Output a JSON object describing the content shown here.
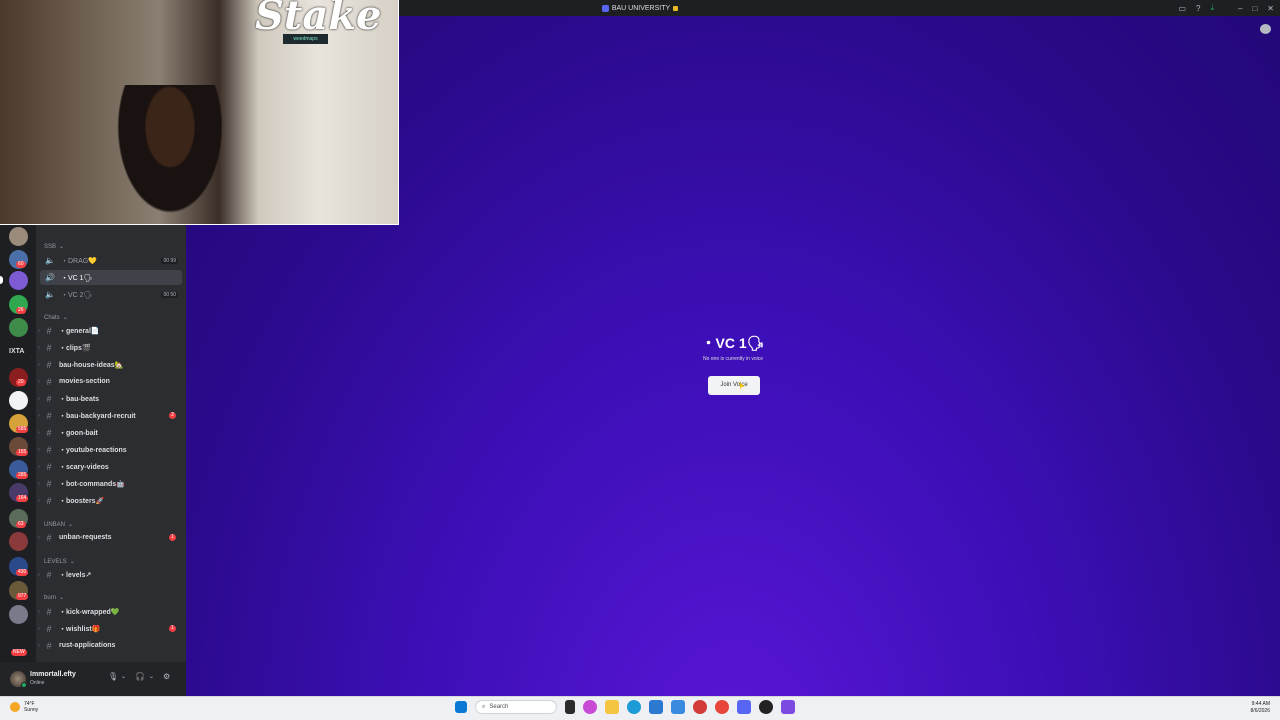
{
  "window": {
    "title": "BAU UNIVERSITY",
    "tools": [
      "inbox-icon",
      "help-icon",
      "download-icon"
    ],
    "controls": [
      "minimize",
      "maximize",
      "close"
    ]
  },
  "overlay": {
    "brand": "Stake",
    "sponsor": "weedmaps"
  },
  "rail": {
    "text_label": "IXTA",
    "badges": [
      "60",
      "26",
      "20",
      "585",
      "155",
      "285",
      "164",
      "63",
      "430",
      "977"
    ],
    "new_badge": "NEW"
  },
  "channels": {
    "categories": {
      "ssb": "SSB",
      "chats": "Chats",
      "unban": "UNBAN",
      "levels": "LEVELS",
      "burn": "burn"
    },
    "voice": [
      {
        "label": "・DRAG💛",
        "counter": "00 99"
      },
      {
        "label": "・VC 1🗣",
        "counter": ""
      },
      {
        "label": "・VC 2🗣",
        "counter": "00 50"
      }
    ],
    "text": [
      {
        "label": "・general📄",
        "unread": ""
      },
      {
        "label": "・clips🎬",
        "unread": ""
      },
      {
        "label": "bau-house-ideas🏡",
        "unread": ""
      },
      {
        "label": "movies-section",
        "unread": ""
      },
      {
        "label": "・bau-beats",
        "unread": ""
      },
      {
        "label": "・bau-backyard-recruit",
        "unread": "2"
      },
      {
        "label": "・goon-bait",
        "unread": ""
      },
      {
        "label": "・youtube-reactions",
        "unread": ""
      },
      {
        "label": "・scary-videos",
        "unread": ""
      },
      {
        "label": "・bot-commands🤖",
        "unread": ""
      },
      {
        "label": "・boosters🚀",
        "unread": ""
      },
      {
        "label": "unban-requests",
        "unread": "1"
      },
      {
        "label": "・levels↗",
        "unread": ""
      },
      {
        "label": "・kick-wrapped💚",
        "unread": ""
      },
      {
        "label": "・wishlist🎁",
        "unread": "1"
      },
      {
        "label": "rust-applications",
        "unread": ""
      }
    ]
  },
  "user": {
    "name": "Immortall.efty",
    "status": "Online"
  },
  "voice_panel": {
    "title": "・VC 1🗣",
    "subtitle": "No one is currently in voice",
    "join_label": "Join Voice"
  },
  "taskbar": {
    "weather_temp": "74°F",
    "weather_desc": "Sunny",
    "search_placeholder": "Search",
    "time": "9:44 AM",
    "date": "8/6/2026"
  }
}
